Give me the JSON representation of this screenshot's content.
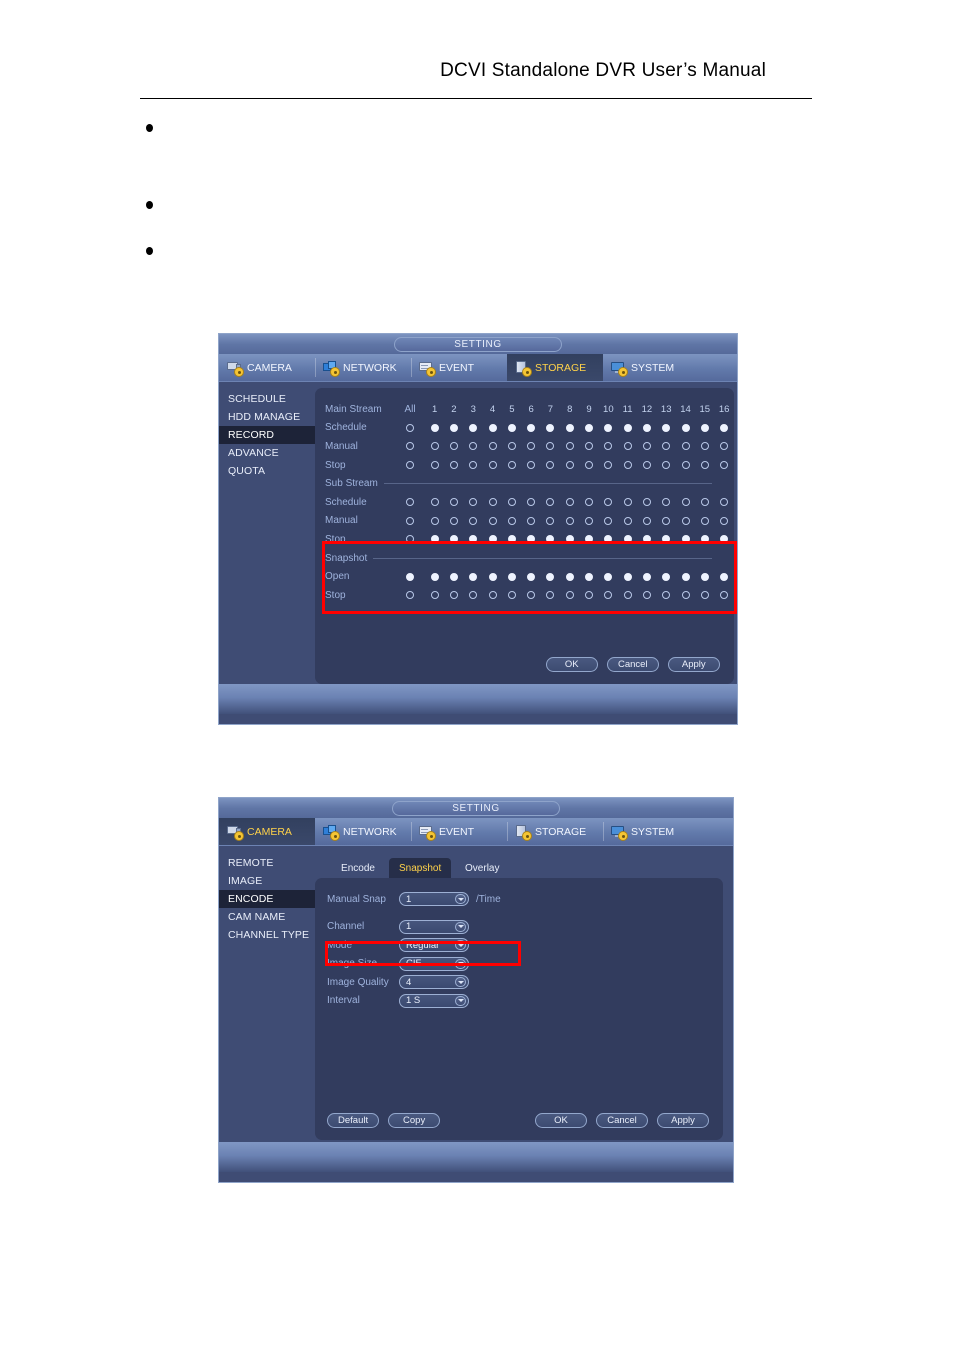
{
  "document": {
    "header_title": "DCVI Standalone DVR User’s Manual",
    "bullets": [
      "",
      "",
      ""
    ]
  },
  "dialog_storage": {
    "window_title": "SETTING",
    "tabs": [
      {
        "label": "CAMERA",
        "icon": "camera-icon",
        "active": false
      },
      {
        "label": "NETWORK",
        "icon": "network-icon",
        "active": false
      },
      {
        "label": "EVENT",
        "icon": "event-icon",
        "active": false
      },
      {
        "label": "STORAGE",
        "icon": "storage-icon",
        "active": true
      },
      {
        "label": "SYSTEM",
        "icon": "system-icon",
        "active": false
      }
    ],
    "sidebar": [
      {
        "label": "SCHEDULE",
        "active": false
      },
      {
        "label": "HDD MANAGE",
        "active": false
      },
      {
        "label": "RECORD",
        "active": true
      },
      {
        "label": "ADVANCE",
        "active": false
      },
      {
        "label": "QUOTA",
        "active": false
      }
    ],
    "channel_header": {
      "label": "Main Stream",
      "all_label": "All",
      "channels": [
        "1",
        "2",
        "3",
        "4",
        "5",
        "6",
        "7",
        "8",
        "9",
        "10",
        "11",
        "12",
        "13",
        "14",
        "15",
        "16"
      ]
    },
    "sub_stream_label": "Sub Stream",
    "snapshot_label": "Snapshot",
    "rows": [
      {
        "group": "main",
        "label": "Schedule",
        "all": false,
        "values": [
          true,
          true,
          true,
          true,
          true,
          true,
          true,
          true,
          true,
          true,
          true,
          true,
          true,
          true,
          true,
          true
        ]
      },
      {
        "group": "main",
        "label": "Manual",
        "all": false,
        "values": [
          false,
          false,
          false,
          false,
          false,
          false,
          false,
          false,
          false,
          false,
          false,
          false,
          false,
          false,
          false,
          false
        ]
      },
      {
        "group": "main",
        "label": "Stop",
        "all": false,
        "values": [
          false,
          false,
          false,
          false,
          false,
          false,
          false,
          false,
          false,
          false,
          false,
          false,
          false,
          false,
          false,
          false
        ]
      },
      {
        "group": "sub",
        "label": "Schedule",
        "all": false,
        "values": [
          false,
          false,
          false,
          false,
          false,
          false,
          false,
          false,
          false,
          false,
          false,
          false,
          false,
          false,
          false,
          false
        ]
      },
      {
        "group": "sub",
        "label": "Manual",
        "all": false,
        "values": [
          false,
          false,
          false,
          false,
          false,
          false,
          false,
          false,
          false,
          false,
          false,
          false,
          false,
          false,
          false,
          false
        ]
      },
      {
        "group": "sub",
        "label": "Stop",
        "all": false,
        "values": [
          true,
          true,
          true,
          true,
          true,
          true,
          true,
          true,
          true,
          true,
          true,
          true,
          true,
          true,
          true,
          true
        ]
      },
      {
        "group": "snapshot",
        "label": "Open",
        "all": true,
        "values": [
          true,
          true,
          true,
          true,
          true,
          true,
          true,
          true,
          true,
          true,
          true,
          true,
          true,
          true,
          true,
          true
        ]
      },
      {
        "group": "snapshot",
        "label": "Stop",
        "all": false,
        "values": [
          false,
          false,
          false,
          false,
          false,
          false,
          false,
          false,
          false,
          false,
          false,
          false,
          false,
          false,
          false,
          false
        ]
      }
    ],
    "buttons": {
      "ok": "OK",
      "cancel": "Cancel",
      "apply": "Apply"
    },
    "highlight_color": "#ff0000"
  },
  "dialog_camera": {
    "window_title": "SETTING",
    "tabs": [
      {
        "label": "CAMERA",
        "icon": "camera-icon",
        "active": true
      },
      {
        "label": "NETWORK",
        "icon": "network-icon",
        "active": false
      },
      {
        "label": "EVENT",
        "icon": "event-icon",
        "active": false
      },
      {
        "label": "STORAGE",
        "icon": "storage-icon",
        "active": false
      },
      {
        "label": "SYSTEM",
        "icon": "system-icon",
        "active": false
      }
    ],
    "sidebar": [
      {
        "label": "REMOTE",
        "active": false
      },
      {
        "label": "IMAGE",
        "active": false
      },
      {
        "label": "ENCODE",
        "active": true
      },
      {
        "label": "CAM NAME",
        "active": false
      },
      {
        "label": "CHANNEL TYPE",
        "active": false
      }
    ],
    "subtabs": [
      {
        "label": "Encode",
        "active": false
      },
      {
        "label": "Snapshot",
        "active": true
      },
      {
        "label": "Overlay",
        "active": false
      }
    ],
    "fields": [
      {
        "label": "Manual Snap",
        "value": "1",
        "suffix": "/Time"
      },
      {
        "label": "Channel",
        "value": "1",
        "suffix": ""
      },
      {
        "label": "Mode",
        "value": "Regular",
        "suffix": ""
      },
      {
        "label": "Image Size",
        "value": "CIF",
        "suffix": ""
      },
      {
        "label": "Image Quality",
        "value": "4",
        "suffix": ""
      },
      {
        "label": "Interval",
        "value": "1 S",
        "suffix": ""
      }
    ],
    "buttons": {
      "default": "Default",
      "copy": "Copy",
      "ok": "OK",
      "cancel": "Cancel",
      "apply": "Apply"
    },
    "highlight_color": "#ff0000"
  }
}
